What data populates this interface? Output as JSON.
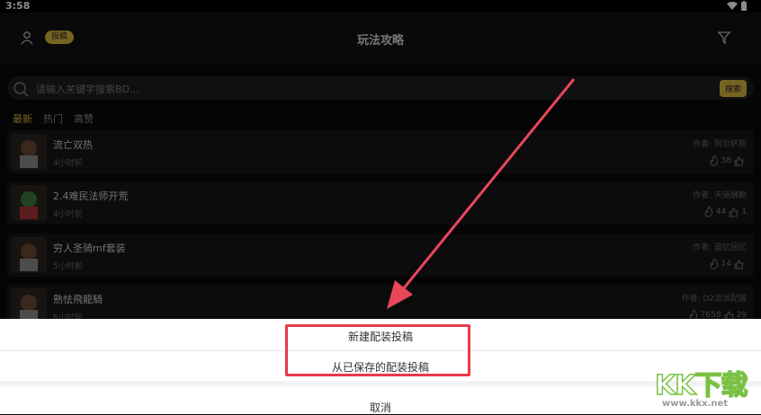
{
  "status_bar": {
    "time": "3:58"
  },
  "header": {
    "submit_label": "投稿",
    "title": "玩法攻略"
  },
  "search": {
    "placeholder": "请输入关键字搜索BD...",
    "button_label": "搜索"
  },
  "tabs": [
    {
      "label": "最新",
      "active": true
    },
    {
      "label": "热门",
      "active": false
    },
    {
      "label": "高赞",
      "active": false
    }
  ],
  "posts": [
    {
      "title": "流亡双热",
      "time": "4小时前",
      "author": "作者: 阿尔萨斯",
      "hot": "38",
      "likes": ""
    },
    {
      "title": "2.4难民法师开荒",
      "time": "4小时前",
      "author": "作者: 天道酬勤",
      "hot": "44",
      "likes": "1"
    },
    {
      "title": "穷人圣骑mf套装",
      "time": "5小时前",
      "author": "作者: 追忆回忆",
      "hot": "14",
      "likes": ""
    },
    {
      "title": "熟怯飛龍騎",
      "time": "6小时前",
      "author": "作者: D2流派配装",
      "hot": "7658",
      "likes": "29"
    }
  ],
  "action_sheet": {
    "options": [
      "新建配装投稿",
      "从已保存的配装投稿"
    ],
    "cancel_label": "取消"
  },
  "watermark": {
    "brand": "KK下载",
    "site": "www.kkx.net"
  },
  "colors": {
    "accent": "#d8b63c",
    "highlight_border": "#e83a4a",
    "arrow": "#e8475a"
  },
  "icons": [
    "user-icon",
    "filter-icon",
    "search-icon",
    "flame-icon",
    "thumbs-up-icon",
    "wifi-icon",
    "battery-icon"
  ]
}
